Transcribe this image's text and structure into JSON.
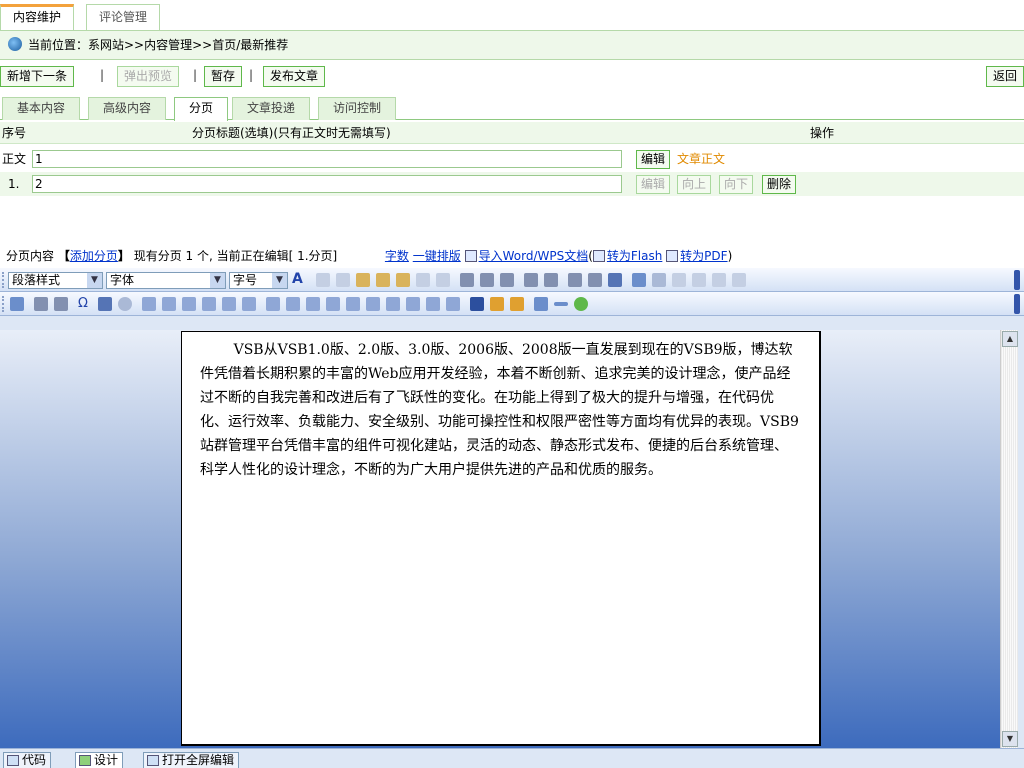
{
  "top_tabs": [
    {
      "label": "内容维护",
      "active": true
    },
    {
      "label": "评论管理",
      "active": false
    }
  ],
  "breadcrumb": {
    "text": "当前位置：系网站>>内容管理>>首页/最新推荐"
  },
  "actions": {
    "add_next": "新增下一条",
    "popup_preview": "弹出预览",
    "save_draft": "暂存",
    "publish": "发布文章",
    "back": "返回"
  },
  "sub_tabs": [
    {
      "label": "基本内容",
      "active": false
    },
    {
      "label": "高级内容",
      "active": false
    },
    {
      "label": "分页",
      "active": true
    },
    {
      "label": "文章投递",
      "active": false
    },
    {
      "label": "访问控制",
      "active": false
    }
  ],
  "paging_table": {
    "col_seq": "序号",
    "col_title": "分页标题(选填)(只有正文时无需填写)",
    "col_ops": "操作",
    "rows": [
      {
        "seq": "正文",
        "value": "1",
        "edit": "编辑",
        "extra": "文章正文"
      },
      {
        "seq": "1.",
        "value": "2",
        "edit": "编辑",
        "up": "向上",
        "down": "向下",
        "delete": "删除"
      }
    ]
  },
  "page_info": {
    "label": "分页内容",
    "add_page": "添加分页",
    "status": "现有分页 1 个, 当前正在编辑[ 1.分页]",
    "word_count": "字数",
    "one_key_format": "一键排版",
    "import_word": "导入Word/WPS文档",
    "to_flash": "转为Flash",
    "to_pdf": "转为PDF"
  },
  "toolbar": {
    "paragraph_style": "段落样式",
    "font": "字体",
    "font_size": "字号"
  },
  "editor_content": "VSB从VSB1.0版、2.0版、3.0版、2006版、2008版一直发展到现在的VSB9版，博达软件凭借着长期积累的丰富的Web应用开发经验，本着不断创新、追求完美的设计理念，使产品经过不断的自我完善和改进后有了飞跃性的变化。在功能上得到了极大的提升与增强，在代码优化、运行效率、负载能力、安全级别、功能可操控性和权限严密性等方面均有优异的表现。VSB9站群管理平台凭借丰富的组件可视化建站，灵活的动态、静态形式发布、便捷的后台系统管理、科学人性化的设计理念，不断的为广大用户提供先进的产品和优质的服务。",
  "mode_buttons": {
    "code": "代码",
    "design": "设计",
    "fullscreen": "打开全屏编辑"
  },
  "colors": {
    "accent_green": "#5fb84a",
    "tab_orange": "#f3a23c",
    "editor_blue": "#3d6bbd",
    "link_blue": "#0033cc",
    "orange_text": "#e08a00"
  }
}
